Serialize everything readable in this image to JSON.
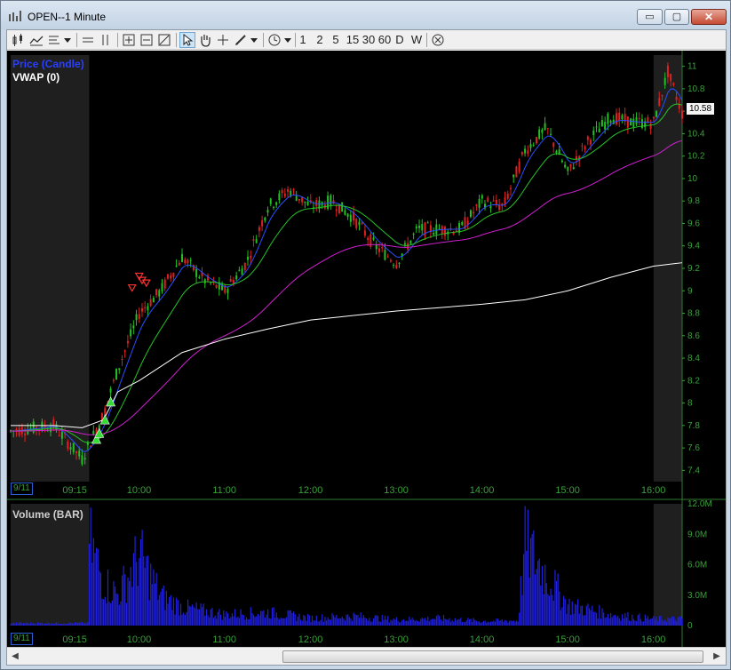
{
  "window": {
    "title": "OPEN--1 Minute"
  },
  "window_buttons": {
    "minimize": "▭",
    "maximize": "▢",
    "close": "✕"
  },
  "toolbar": {
    "intervals": [
      "1",
      "2",
      "5",
      "15",
      "30",
      "60",
      "D",
      "W"
    ],
    "icons": [
      "candle-style-icon",
      "line-style-icon",
      "bar-style-icon",
      "dropdown-icon",
      "horizontal-line-icon",
      "vertical-lines-icon",
      "zoom-fit-icon",
      "zoom-out-icon",
      "zoom-in-icon",
      "pointer-icon",
      "hand-icon",
      "crosshair-icon",
      "pen-icon",
      "dropdown-icon",
      "clock-icon",
      "dropdown-icon",
      "close-circle-icon"
    ]
  },
  "price_panel": {
    "legend_price": "Price (Candle)",
    "legend_vwap": "VWAP (0)",
    "last_price": "10.58",
    "y_ticks": [
      "11",
      "10.8",
      "10.6",
      "10.4",
      "10.2",
      "10",
      "9.8",
      "9.6",
      "9.4",
      "9.2",
      "9",
      "8.8",
      "8.6",
      "8.4",
      "8.2",
      "8",
      "7.8",
      "7.6",
      "7.4"
    ],
    "date_label": "9/11",
    "time_ticks": [
      "09:15",
      "10:00",
      "11:00",
      "12:00",
      "13:00",
      "14:00",
      "15:00",
      "16:00"
    ]
  },
  "volume_panel": {
    "legend": "Volume (BAR)",
    "y_ticks": [
      "12.0M",
      "9.0M",
      "6.0M",
      "3.0M",
      "0"
    ],
    "date_label": "9/11",
    "time_ticks": [
      "09:15",
      "10:00",
      "11:00",
      "12:00",
      "13:00",
      "14:00",
      "15:00",
      "16:00"
    ]
  },
  "colors": {
    "background": "#000000",
    "extended_hours": "#1f1f1f",
    "axis_text": "#3aa03a",
    "candle_up": "#22c022",
    "candle_down": "#e02020",
    "ema_fast": "#2a4fff",
    "ema_mid": "#26c426",
    "ema_slow": "#d020d0",
    "vwap": "#ffffff",
    "volume": "#2020e0",
    "legend_price": "#2a3fff",
    "signal_up": "#33dd33",
    "signal_down": "#ff3030"
  },
  "chart_data": {
    "type": "line",
    "title": "OPEN--1 Minute",
    "xlabel": "",
    "ylabel": "",
    "ylim": [
      7.3,
      11.1
    ],
    "x_ticks": [
      "09:15",
      "10:00",
      "11:00",
      "12:00",
      "13:00",
      "14:00",
      "15:00",
      "16:00"
    ],
    "series": [
      {
        "name": "Price (Candle)",
        "x": [
          "08:30",
          "09:00",
          "09:20",
          "09:35",
          "09:45",
          "10:00",
          "10:15",
          "10:30",
          "10:45",
          "11:00",
          "11:15",
          "11:30",
          "11:45",
          "12:00",
          "12:15",
          "12:30",
          "12:45",
          "13:00",
          "13:15",
          "13:30",
          "13:45",
          "14:00",
          "14:15",
          "14:30",
          "14:45",
          "15:00",
          "15:15",
          "15:30",
          "15:45",
          "16:00",
          "16:10",
          "16:20"
        ],
        "values": [
          7.75,
          7.8,
          7.5,
          7.9,
          8.3,
          8.8,
          9.0,
          9.3,
          9.1,
          9.0,
          9.25,
          9.75,
          9.9,
          9.75,
          9.8,
          9.65,
          9.4,
          9.25,
          9.55,
          9.55,
          9.55,
          9.8,
          9.75,
          10.25,
          10.45,
          10.05,
          10.35,
          10.55,
          10.5,
          10.5,
          10.95,
          10.58
        ]
      },
      {
        "name": "VWAP (0)",
        "x": [
          "08:30",
          "09:00",
          "09:20",
          "09:35",
          "09:45",
          "10:00",
          "10:30",
          "11:00",
          "11:30",
          "12:00",
          "12:30",
          "13:00",
          "13:30",
          "14:00",
          "14:30",
          "15:00",
          "15:30",
          "16:00",
          "16:20"
        ],
        "values": [
          7.8,
          7.8,
          7.78,
          7.85,
          8.1,
          8.2,
          8.45,
          8.57,
          8.66,
          8.74,
          8.78,
          8.82,
          8.85,
          8.88,
          8.92,
          9.0,
          9.12,
          9.22,
          9.25
        ]
      }
    ],
    "volume": {
      "name": "Volume (BAR)",
      "ylim": [
        0,
        12000000
      ],
      "x": [
        "09:15",
        "09:25",
        "09:35",
        "09:45",
        "10:00",
        "10:15",
        "10:30",
        "11:00",
        "11:30",
        "12:00",
        "12:30",
        "13:00",
        "13:30",
        "14:00",
        "14:25",
        "14:30",
        "15:00",
        "15:30",
        "16:00"
      ],
      "values": [
        300000,
        11500000,
        6000000,
        4200000,
        9500000,
        4000000,
        2500000,
        1500000,
        1800000,
        1000000,
        1300000,
        800000,
        1000000,
        600000,
        700000,
        11000000,
        2800000,
        1500000,
        900000
      ]
    },
    "signals": {
      "buy": [
        "09:30",
        "09:32",
        "09:36",
        "09:40"
      ],
      "sell": [
        "09:55",
        "10:00",
        "10:02",
        "10:05"
      ]
    },
    "grid": false
  }
}
